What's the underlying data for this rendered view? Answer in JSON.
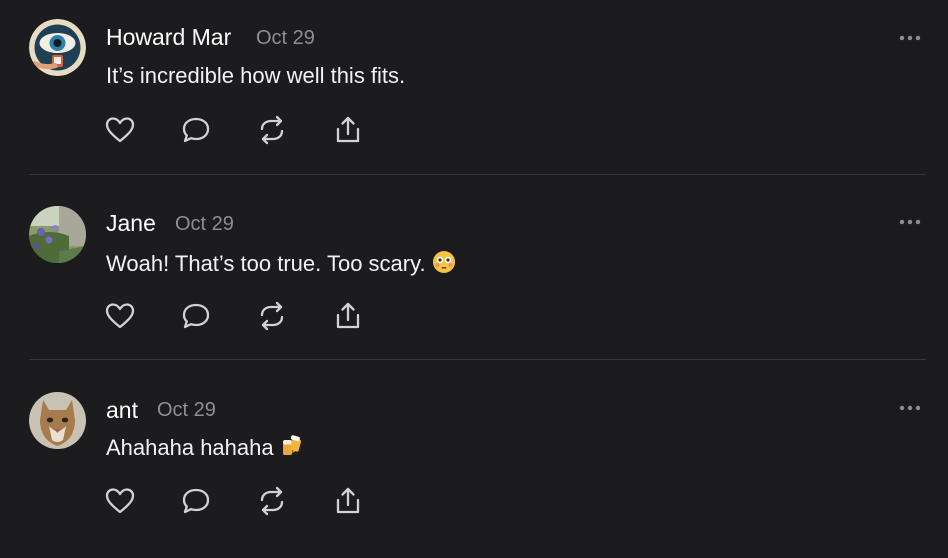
{
  "colors": {
    "background": "#1c1c1e",
    "text": "#f2f2f7",
    "muted": "#8e8e93",
    "icon": "#d1d1d6",
    "divider": "#38383a"
  },
  "posts": [
    {
      "author": "Howard Mar",
      "date": "Oct 29",
      "text": "It’s incredible how well this fits.",
      "emoji": "",
      "avatar": "eye-illustration-avatar"
    },
    {
      "author": "Jane",
      "date": "Oct 29",
      "text": "Woah! That’s too true. Too scary.",
      "emoji": "flushed-face-emoji",
      "avatar": "garden-flowers-photo-avatar"
    },
    {
      "author": "ant",
      "date": "Oct 29",
      "text": "Ahahaha hahaha",
      "emoji": "beer-mugs-emoji",
      "avatar": "cougar-photo-avatar"
    }
  ],
  "actions": [
    "heart-icon",
    "comment-icon",
    "repost-icon",
    "share-icon"
  ]
}
